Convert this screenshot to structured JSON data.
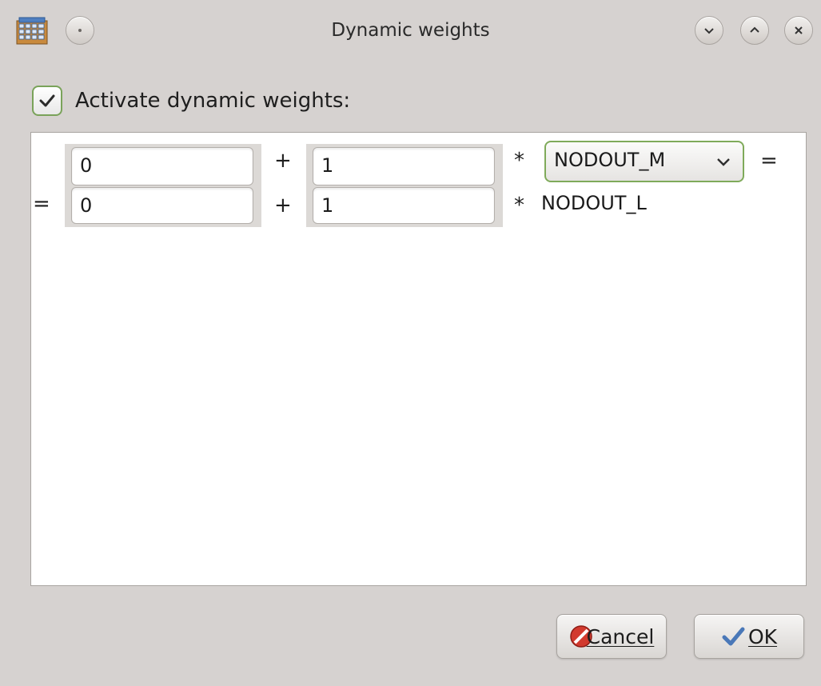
{
  "window": {
    "title": "Dynamic weights"
  },
  "activate": {
    "label": "Activate dynamic weights:",
    "checked": true
  },
  "rows": [
    {
      "leading": "",
      "offset": "0",
      "plus": "+",
      "factor": "1",
      "times": "*",
      "variable": "NODOUT_M",
      "trailing": "="
    },
    {
      "leading": "=",
      "offset": "0",
      "plus": "+",
      "factor": "1",
      "times": "*",
      "variable": "NODOUT_L",
      "trailing": ""
    }
  ],
  "buttons": {
    "cancel": "Cancel",
    "ok": "OK"
  },
  "colors": {
    "accent": "#7faa5a",
    "window_bg": "#d6d2d0"
  }
}
